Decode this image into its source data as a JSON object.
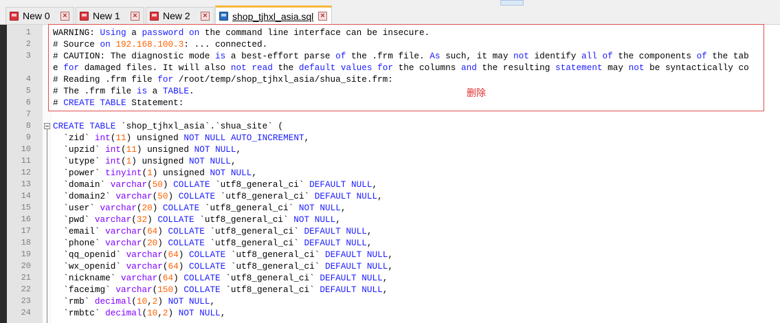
{
  "tabs": [
    {
      "label": "New 0",
      "active": false,
      "icon": "red-disk-icon"
    },
    {
      "label": "New 1",
      "active": false,
      "icon": "red-disk-icon"
    },
    {
      "label": "New 2",
      "active": false,
      "icon": "red-disk-icon"
    },
    {
      "label": "shop_tjhxl_asia.sql",
      "active": true,
      "icon": "blue-disk-icon"
    }
  ],
  "annotation": "删除",
  "colors": {
    "keyword": "#1b1bff",
    "type": "#8000ff",
    "number": "#ff6000",
    "highlight_box": "#e05050",
    "active_tab_accent": "#f6b53a"
  },
  "lines": [
    {
      "num": "1",
      "text": "WARNING: Using a password on the command line interface can be insecure."
    },
    {
      "num": "2",
      "text": "# Source on 192.168.100.3: ... connected."
    },
    {
      "num": "3",
      "text": "# CAUTION: The diagnostic mode is a best-effort parse of the .frm file. As such, it may not identify all of the components of the tab"
    },
    {
      "num": "",
      "text": "e for damaged files. It will also not read the default values for the columns and the resulting statement may not be syntactically co"
    },
    {
      "num": "4",
      "text": "# Reading .frm file for /root/temp/shop_tjhxl_asia/shua_site.frm:"
    },
    {
      "num": "5",
      "text": "# The .frm file is a TABLE."
    },
    {
      "num": "6",
      "text": "# CREATE TABLE Statement:"
    },
    {
      "num": "7",
      "text": ""
    },
    {
      "num": "8",
      "text": "CREATE TABLE `shop_tjhxl_asia`.`shua_site` ("
    },
    {
      "num": "9",
      "text": "  `zid` int(11) unsigned NOT NULL AUTO_INCREMENT,"
    },
    {
      "num": "10",
      "text": "  `upzid` int(11) unsigned NOT NULL,"
    },
    {
      "num": "11",
      "text": "  `utype` int(1) unsigned NOT NULL,"
    },
    {
      "num": "12",
      "text": "  `power` tinyint(1) unsigned NOT NULL,"
    },
    {
      "num": "13",
      "text": "  `domain` varchar(50) COLLATE `utf8_general_ci` DEFAULT NULL,"
    },
    {
      "num": "14",
      "text": "  `domain2` varchar(50) COLLATE `utf8_general_ci` DEFAULT NULL,"
    },
    {
      "num": "15",
      "text": "  `user` varchar(20) COLLATE `utf8_general_ci` NOT NULL,"
    },
    {
      "num": "16",
      "text": "  `pwd` varchar(32) COLLATE `utf8_general_ci` NOT NULL,"
    },
    {
      "num": "17",
      "text": "  `email` varchar(64) COLLATE `utf8_general_ci` DEFAULT NULL,"
    },
    {
      "num": "18",
      "text": "  `phone` varchar(20) COLLATE `utf8_general_ci` DEFAULT NULL,"
    },
    {
      "num": "19",
      "text": "  `qq_openid` varchar(64) COLLATE `utf8_general_ci` DEFAULT NULL,"
    },
    {
      "num": "20",
      "text": "  `wx_openid` varchar(64) COLLATE `utf8_general_ci` DEFAULT NULL,"
    },
    {
      "num": "21",
      "text": "  `nickname` varchar(64) COLLATE `utf8_general_ci` DEFAULT NULL,"
    },
    {
      "num": "22",
      "text": "  `faceimg` varchar(150) COLLATE `utf8_general_ci` DEFAULT NULL,"
    },
    {
      "num": "23",
      "text": "  `rmb` decimal(10,2) NOT NULL,"
    },
    {
      "num": "24",
      "text": "  `rmbtc` decimal(10,2) NOT NULL,"
    }
  ]
}
